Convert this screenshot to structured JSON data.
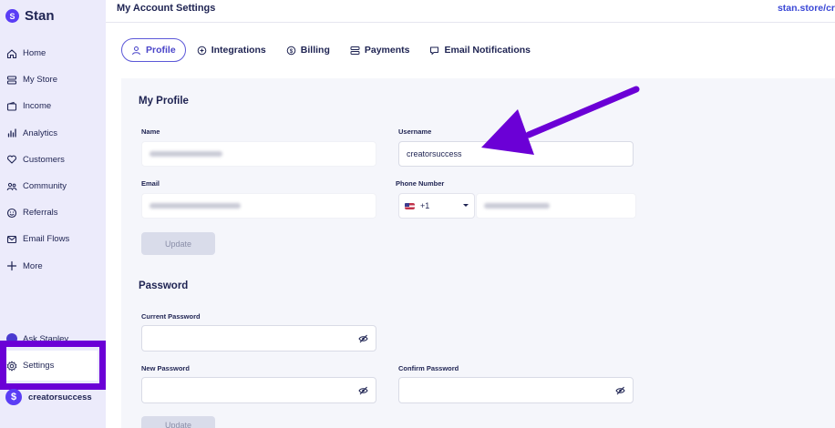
{
  "sidebar": {
    "brand": "Stan",
    "brand_icon": "stan-logo-icon",
    "items": [
      {
        "label": "Home",
        "icon": "home-icon"
      },
      {
        "label": "My Store",
        "icon": "store-icon"
      },
      {
        "label": "Income",
        "icon": "wallet-icon"
      },
      {
        "label": "Analytics",
        "icon": "analytics-icon"
      },
      {
        "label": "Customers",
        "icon": "heart-icon"
      },
      {
        "label": "Community",
        "icon": "community-icon"
      },
      {
        "label": "Referrals",
        "icon": "referrals-icon"
      },
      {
        "label": "Email Flows",
        "icon": "mail-icon"
      },
      {
        "label": "More",
        "icon": "plus-icon"
      }
    ],
    "ask": "Ask Stanley",
    "settings": "Settings",
    "account_name": "creatorsuccess",
    "accent_color": "#6b00d6"
  },
  "header": {
    "title": "My Account Settings",
    "store_link": "stan.store/cr"
  },
  "tabs": [
    {
      "label": "Profile",
      "active": true
    },
    {
      "label": "Integrations",
      "active": false
    },
    {
      "label": "Billing",
      "active": false
    },
    {
      "label": "Payments",
      "active": false
    },
    {
      "label": "Email Notifications",
      "active": false
    }
  ],
  "profile": {
    "section_title": "My Profile",
    "name_label": "Name",
    "username_label": "Username",
    "username_value": "creatorsuccess",
    "email_label": "Email",
    "phone_label": "Phone Number",
    "country_code": "+1",
    "update_label": "Update"
  },
  "password": {
    "section_title": "Password",
    "current_label": "Current Password",
    "new_label": "New Password",
    "confirm_label": "Confirm Password",
    "update_label": "Update"
  },
  "annotation": {
    "arrow_color": "#6b00d6"
  }
}
